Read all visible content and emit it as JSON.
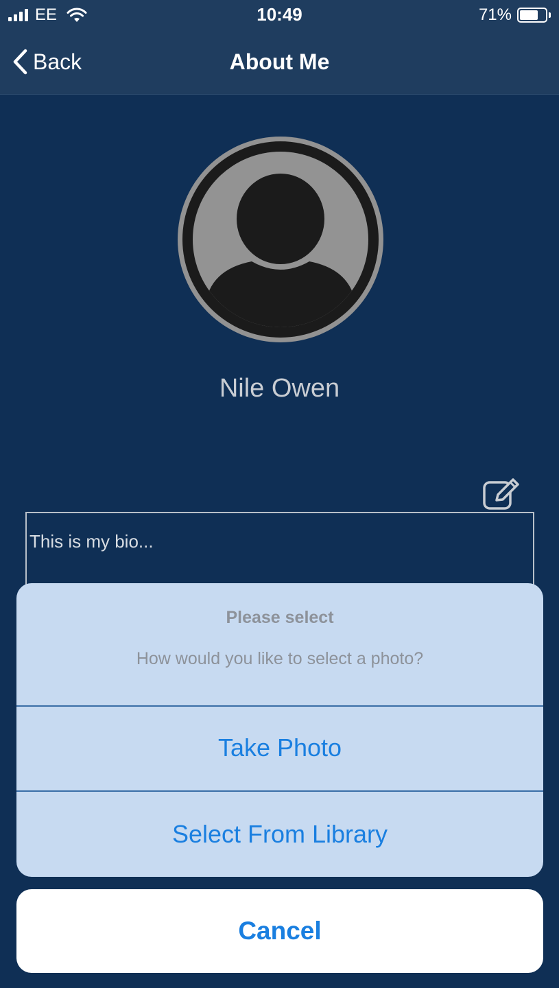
{
  "status_bar": {
    "carrier": "EE",
    "time": "10:49",
    "battery_percent": "71%",
    "battery_level": 0.71
  },
  "nav": {
    "back_label": "Back",
    "title": "About Me"
  },
  "profile": {
    "name": "Nile Owen",
    "bio": "This is my bio..."
  },
  "action_sheet": {
    "title": "Please select",
    "message": "How would you like to select a photo?",
    "options": [
      "Take Photo",
      "Select From Library"
    ],
    "cancel_label": "Cancel"
  },
  "colors": {
    "background": "#0f2f55",
    "nav_bar": "#1f3d5f",
    "sheet": "#c7daf1",
    "accent": "#1a7fe0"
  }
}
